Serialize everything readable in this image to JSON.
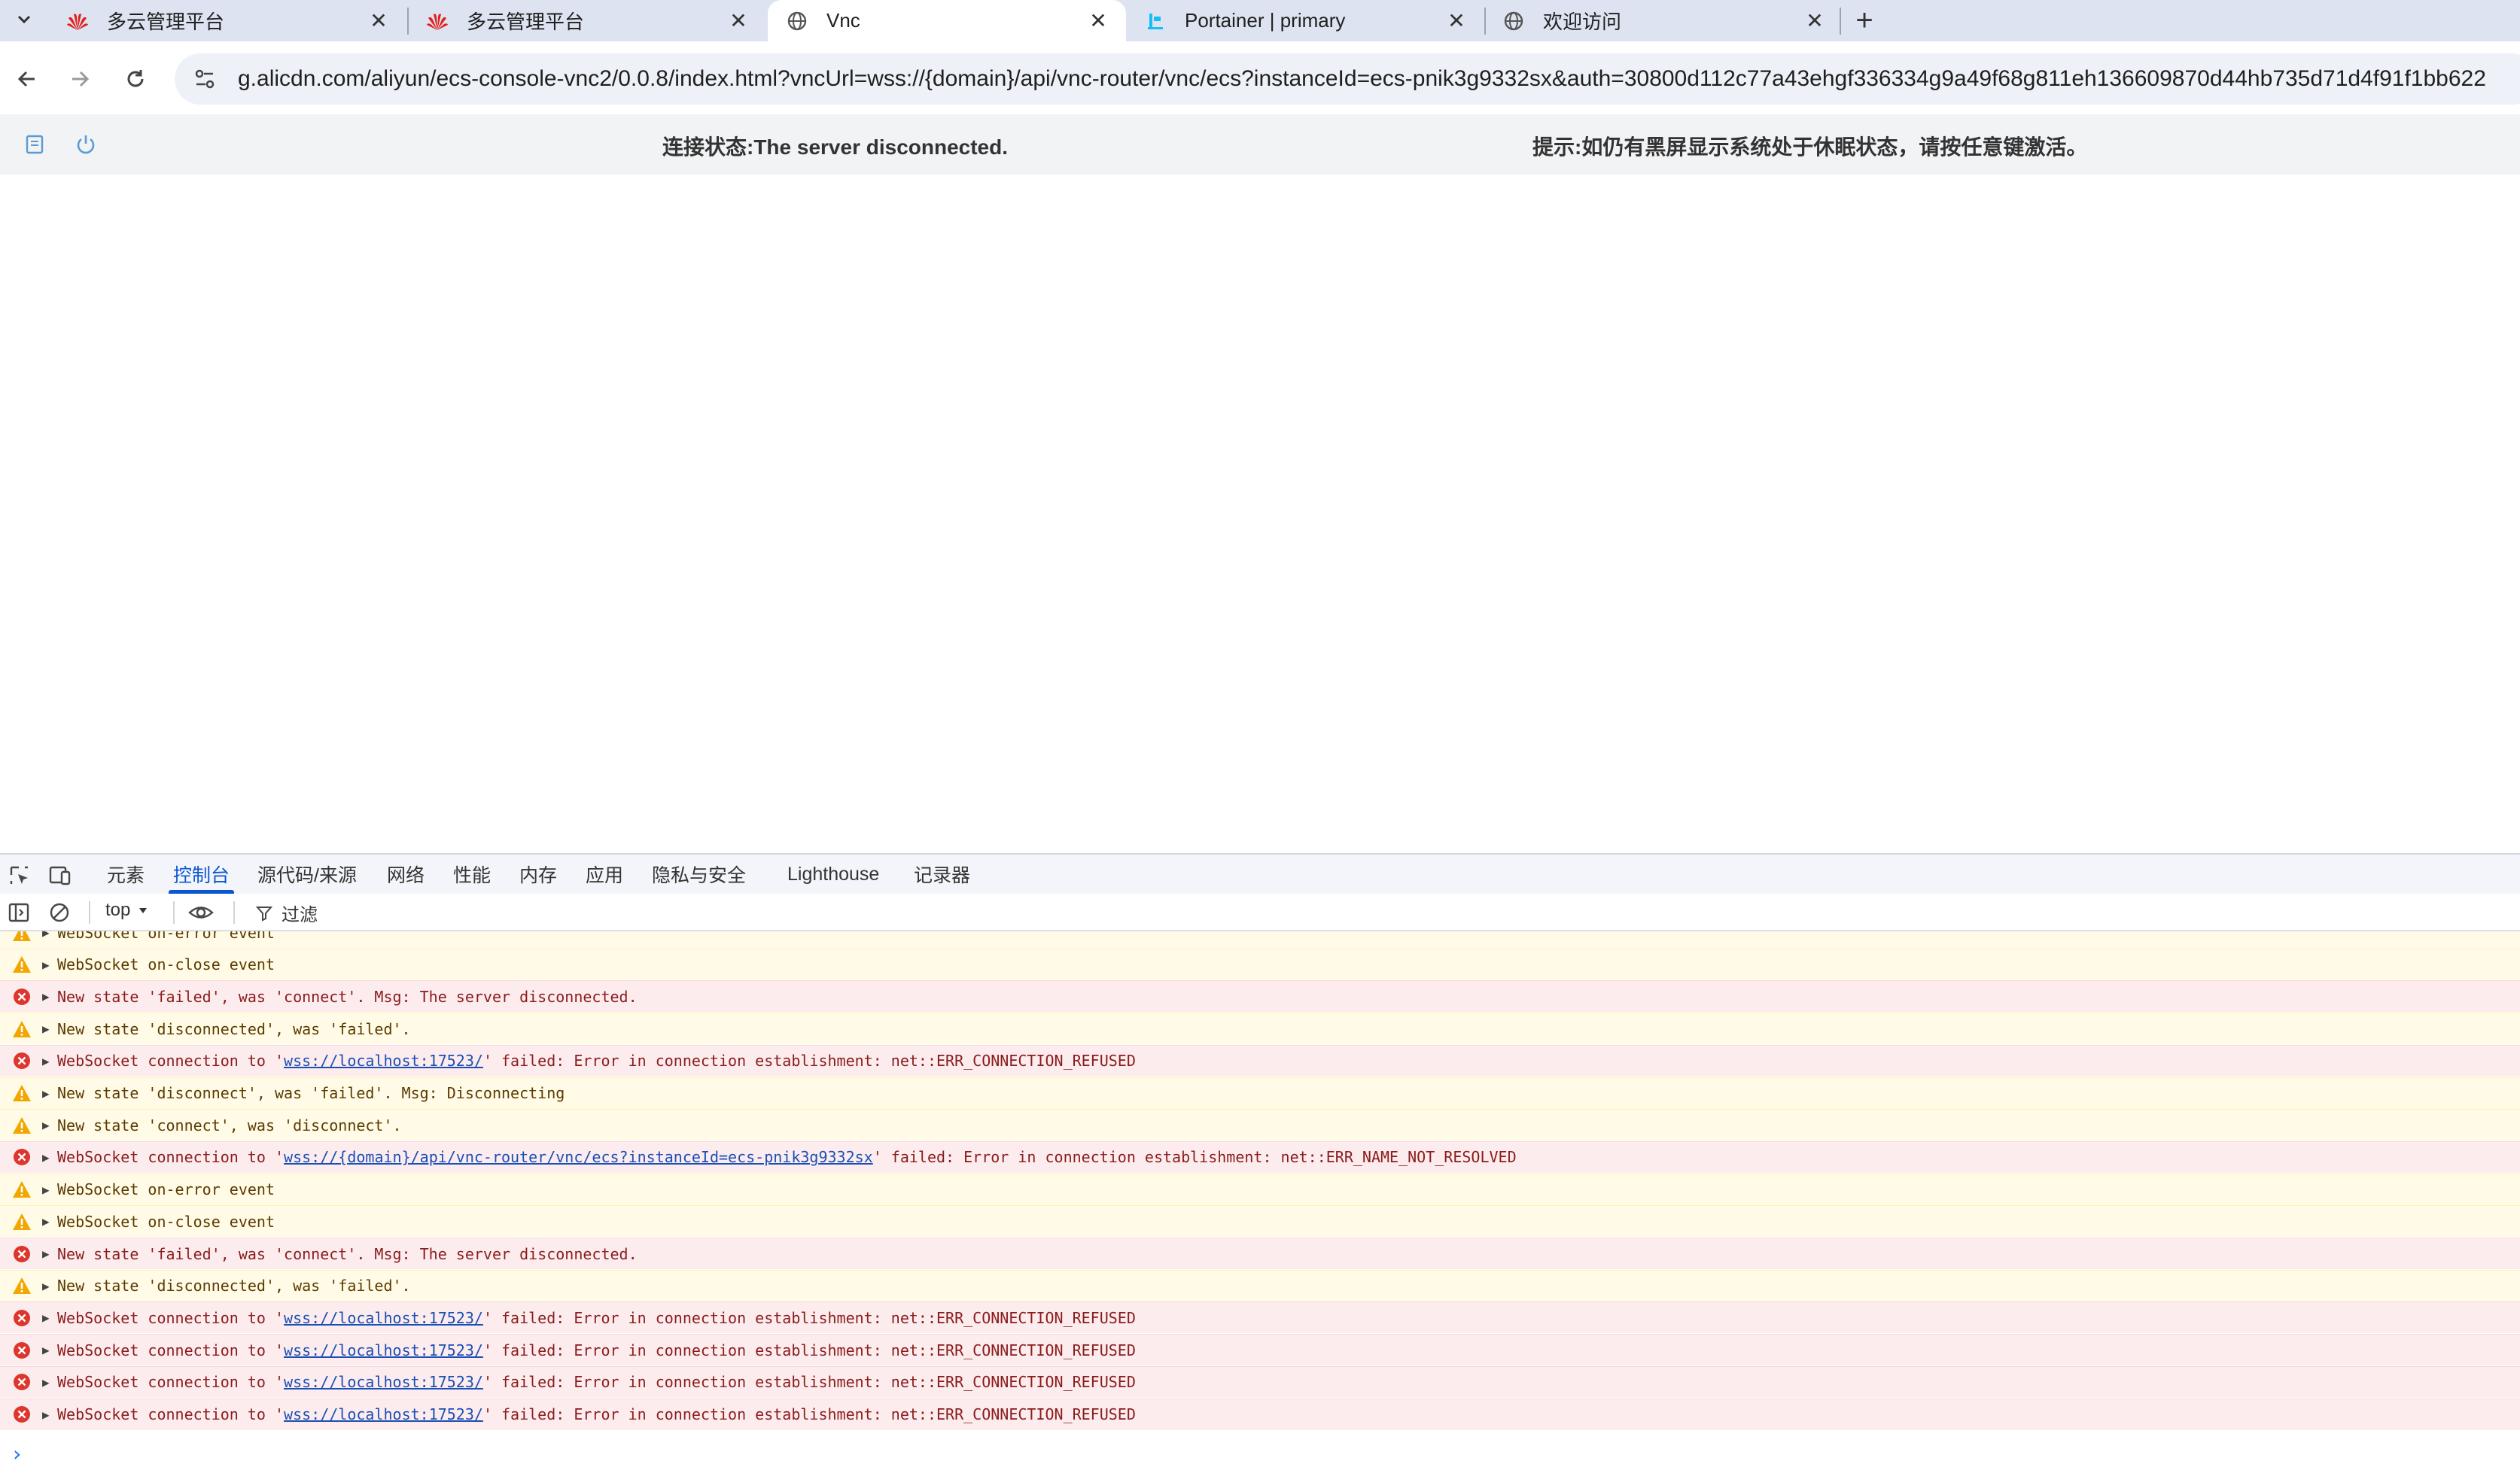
{
  "browser": {
    "tabs": [
      {
        "title": "多云管理平台",
        "icon": "huawei-logo-icon",
        "active": false
      },
      {
        "title": "多云管理平台",
        "icon": "huawei-logo-icon",
        "active": false
      },
      {
        "title": "Vnc",
        "icon": "globe-icon",
        "active": true
      },
      {
        "title": "Portainer | primary",
        "icon": "portainer-logo-icon",
        "active": false
      },
      {
        "title": "欢迎访问",
        "icon": "globe-icon",
        "active": false
      }
    ],
    "new_tab_label": "+",
    "address": "g.alicdn.com/aliyun/ecs-console-vnc2/0.0.8/index.html?vncUrl=wss://{domain}/api/vnc-router/vnc/ecs?instanceId=ecs-pnik3g9332sx&auth=30800d112c77a43ehgf336334g9a49f68g811eh136609870d44hb735d71d4f91f1bb622"
  },
  "vnc": {
    "status": "连接状态:The server disconnected.",
    "tip": "提示:如仍有黑屏显示系统处于休眠状态，请按任意键激活。"
  },
  "devtools": {
    "tabs": [
      "元素",
      "控制台",
      "源代码/来源",
      "网络",
      "性能",
      "内存",
      "应用",
      "隐私与安全",
      "Lighthouse",
      "记录器"
    ],
    "active_tab": "控制台",
    "context": "top",
    "filter_placeholder": "过滤",
    "colors": {
      "accent": "#0b57d0",
      "warn_bg": "#fffbe6",
      "error_bg": "#fdecee"
    },
    "messages": [
      {
        "level": "warn",
        "text": "WebSocket on-error event"
      },
      {
        "level": "warn",
        "text": "WebSocket on-close event"
      },
      {
        "level": "error",
        "text": "New state 'failed', was 'connect'. Msg: The server disconnected."
      },
      {
        "level": "warn",
        "text": "New state 'disconnected', was 'failed'."
      },
      {
        "level": "error",
        "prefix": "WebSocket connection to '",
        "link": "wss://localhost:17523/",
        "suffix": "' failed: Error in connection establishment: net::ERR_CONNECTION_REFUSED"
      },
      {
        "level": "warn",
        "text": "New state 'disconnect', was 'failed'. Msg: Disconnecting"
      },
      {
        "level": "warn",
        "text": "New state 'connect', was 'disconnect'."
      },
      {
        "level": "error",
        "prefix": "WebSocket connection to '",
        "link": "wss://{domain}/api/vnc-router/vnc/ecs?instanceId=ecs-pnik3g9332sx",
        "suffix": "' failed: Error in connection establishment: net::ERR_NAME_NOT_RESOLVED"
      },
      {
        "level": "warn",
        "text": "WebSocket on-error event"
      },
      {
        "level": "warn",
        "text": "WebSocket on-close event"
      },
      {
        "level": "error",
        "text": "New state 'failed', was 'connect'. Msg: The server disconnected."
      },
      {
        "level": "warn",
        "text": "New state 'disconnected', was 'failed'."
      },
      {
        "level": "error",
        "prefix": "WebSocket connection to '",
        "link": "wss://localhost:17523/",
        "suffix": "' failed: Error in connection establishment: net::ERR_CONNECTION_REFUSED"
      },
      {
        "level": "error",
        "prefix": "WebSocket connection to '",
        "link": "wss://localhost:17523/",
        "suffix": "' failed: Error in connection establishment: net::ERR_CONNECTION_REFUSED"
      },
      {
        "level": "error",
        "prefix": "WebSocket connection to '",
        "link": "wss://localhost:17523/",
        "suffix": "' failed: Error in connection establishment: net::ERR_CONNECTION_REFUSED"
      },
      {
        "level": "error",
        "prefix": "WebSocket connection to '",
        "link": "wss://localhost:17523/",
        "suffix": "' failed: Error in connection establishment: net::ERR_CONNECTION_REFUSED"
      }
    ],
    "prompt": "›"
  }
}
